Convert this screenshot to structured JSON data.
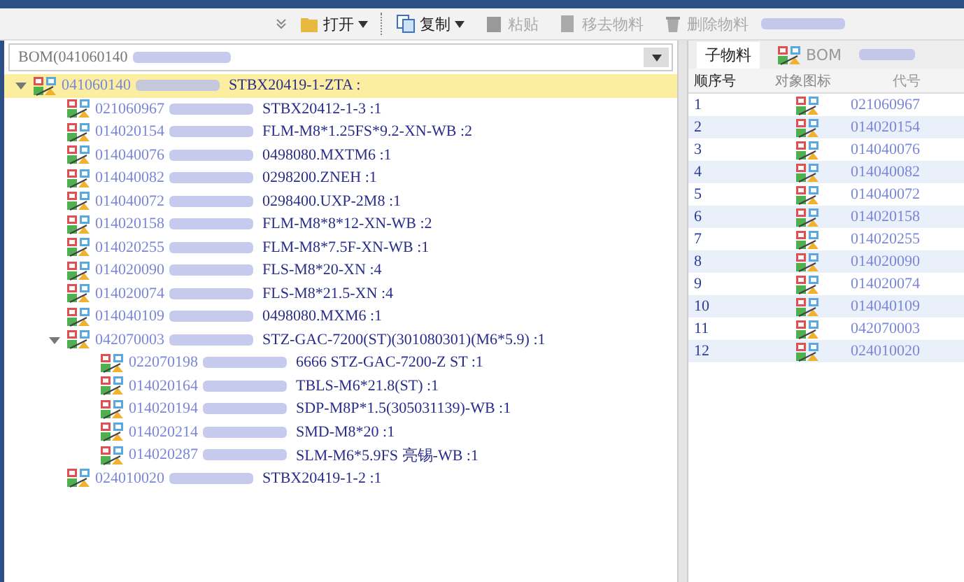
{
  "toolbar": [
    {
      "label": "打开",
      "kind": "menu",
      "disabled": false
    },
    {
      "label": "复制",
      "kind": "menu",
      "disabled": false
    },
    {
      "label": "粘贴",
      "kind": "plain",
      "disabled": true
    },
    {
      "label": "移去物料",
      "kind": "plain",
      "disabled": true
    },
    {
      "label": "删除物料",
      "kind": "plain",
      "disabled": true
    }
  ],
  "bom_selector": {
    "value": "BOM(041060140"
  },
  "tree": [
    {
      "code": "041060140",
      "spec": "STBX20419-1-ZTA :",
      "selected": true,
      "expanded": true,
      "children": [
        {
          "code": "021060967",
          "spec": "STBX20412-1-3 :1",
          "selected": false
        },
        {
          "code": "014020154",
          "spec": "FLM-M8*1.25FS*9.2-XN-WB :2",
          "selected": false
        },
        {
          "code": "014040076",
          "spec": "0498080.MXTM6 :1",
          "selected": false
        },
        {
          "code": "014040082",
          "spec": "0298200.ZNEH :1",
          "selected": false
        },
        {
          "code": "014040072",
          "spec": "0298400.UXP-2M8 :1",
          "selected": false
        },
        {
          "code": "014020158",
          "spec": "FLM-M8*8*12-XN-WB :2",
          "selected": false
        },
        {
          "code": "014020255",
          "spec": "FLM-M8*7.5F-XN-WB :1",
          "selected": false
        },
        {
          "code": "014020090",
          "spec": "FLS-M8*20-XN :4",
          "selected": false
        },
        {
          "code": "014020074",
          "spec": "FLS-M8*21.5-XN :4",
          "selected": false
        },
        {
          "code": "014040109",
          "spec": "0498080.MXM6 :1",
          "selected": false
        },
        {
          "code": "042070003",
          "spec": "STZ-GAC-7200(ST)(301080301)(M6*5.9) :1",
          "selected": false,
          "expanded": true,
          "children": [
            {
              "code": "022070198",
              "spec": "6666 STZ-GAC-7200-Z ST :1",
              "selected": false
            },
            {
              "code": "014020164",
              "spec": "TBLS-M6*21.8(ST) :1",
              "selected": false
            },
            {
              "code": "014020194",
              "spec": "SDP-M8P*1.5(305031139)-WB :1",
              "selected": false
            },
            {
              "code": "014020214",
              "spec": "SMD-M8*20 :1",
              "selected": false
            },
            {
              "code": "014020287",
              "spec": "SLM-M6*5.9FS 亮锡-WB :1",
              "selected": false
            }
          ]
        },
        {
          "code": "024010020",
          "spec": "STBX20419-1-2 :1",
          "selected": false
        }
      ]
    }
  ],
  "tabs": [
    {
      "label": "子物料",
      "selected": true,
      "icon": false
    },
    {
      "label": "BOM",
      "selected": false,
      "icon": true
    }
  ],
  "table": {
    "columns": [
      "顺序号",
      "对象图标",
      "代号"
    ],
    "rows": [
      {
        "seq": "1",
        "code": "021060967"
      },
      {
        "seq": "2",
        "code": "014020154"
      },
      {
        "seq": "3",
        "code": "014040076"
      },
      {
        "seq": "4",
        "code": "014040082"
      },
      {
        "seq": "5",
        "code": "014040072"
      },
      {
        "seq": "6",
        "code": "014020158"
      },
      {
        "seq": "7",
        "code": "014020255"
      },
      {
        "seq": "8",
        "code": "014020090"
      },
      {
        "seq": "9",
        "code": "014020074"
      },
      {
        "seq": "10",
        "code": "014040109"
      },
      {
        "seq": "11",
        "code": "042070003"
      },
      {
        "seq": "12",
        "code": "024010020"
      }
    ]
  }
}
